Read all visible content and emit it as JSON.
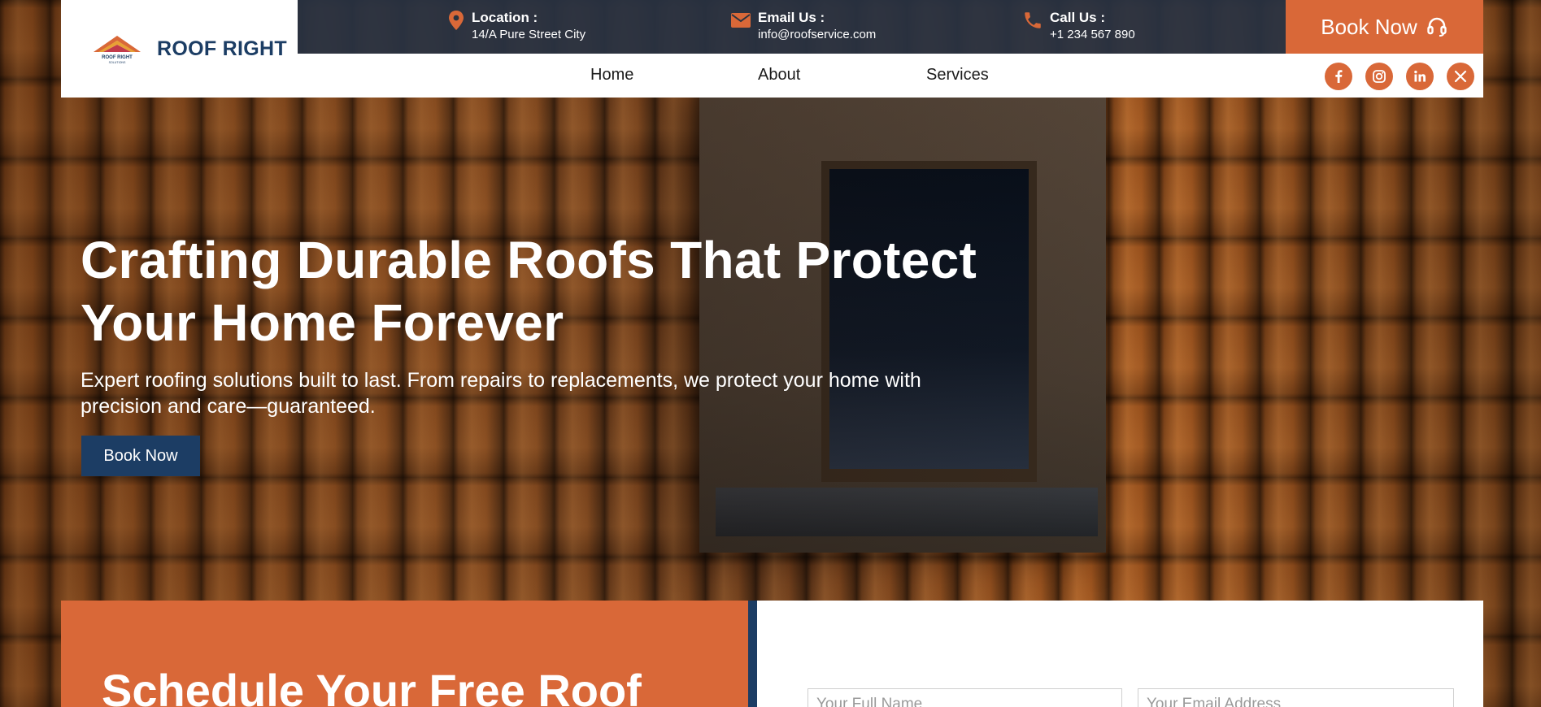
{
  "brand": {
    "name": "ROOF RIGHT",
    "logo_small_text": "ROOF RIGHT",
    "logo_tagline": "SOLUTIONS"
  },
  "topbar": {
    "location": {
      "label": "Location :",
      "value": "14/A Pure Street City",
      "icon": "map-pin-icon"
    },
    "email": {
      "label": "Email Us :",
      "value": "info@roofservice.com",
      "icon": "envelope-icon"
    },
    "call": {
      "label": "Call Us :",
      "value": "+1 234 567 890",
      "icon": "phone-icon"
    },
    "book_label": "Book Now",
    "book_icon": "headset-icon"
  },
  "nav": {
    "items": [
      {
        "label": "Home"
      },
      {
        "label": "About"
      },
      {
        "label": "Services"
      }
    ],
    "social": [
      "facebook-icon",
      "instagram-icon",
      "linkedin-icon",
      "x-icon"
    ]
  },
  "hero": {
    "title_line1": "Crafting Durable Roofs That Protect",
    "title_line2": "Your Home Forever",
    "subtitle": "Expert roofing solutions built to last. From repairs to replacements, we protect your home with precision and care—guaranteed.",
    "button_label": "Book Now"
  },
  "schedule": {
    "title": "Schedule Your Free Roof",
    "name_placeholder": "Your Full Name",
    "email_placeholder": "Your Email Address"
  },
  "colors": {
    "accent": "#d96838",
    "navy": "#1c3d64",
    "topbar": "#28323f"
  }
}
